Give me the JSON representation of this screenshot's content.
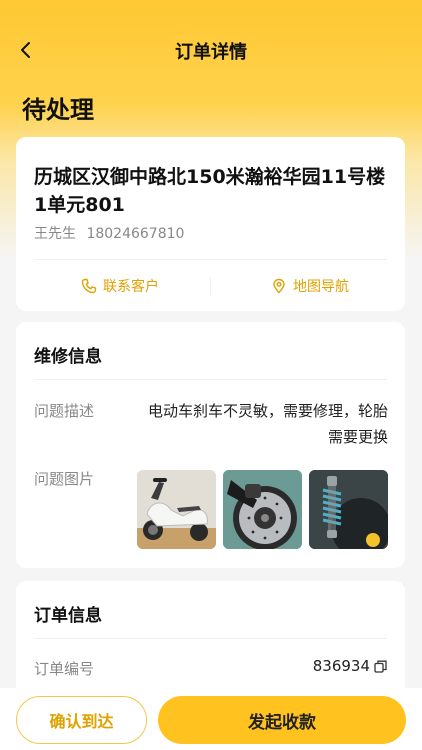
{
  "nav": {
    "title": "订单详情"
  },
  "status": "待处理",
  "address": {
    "text": "历城区汉御中路北150米瀚裕华园11号楼1单元801",
    "name": "王先生",
    "phone": "18024667810",
    "contact_label": "联系客户",
    "map_label": "地图导航"
  },
  "repair": {
    "title": "维修信息",
    "desc_label": "问题描述",
    "desc_value": "电动车刹车不灵敏，需要修理，轮胎需要更换",
    "images_label": "问题图片"
  },
  "order": {
    "title": "订单信息",
    "number_label": "订单编号",
    "number_value": "836934"
  },
  "actions": {
    "confirm_label": "确认到达",
    "collect_label": "发起收款"
  },
  "colors": {
    "accent": "#ffc21f",
    "accent_text": "#e0a200"
  }
}
